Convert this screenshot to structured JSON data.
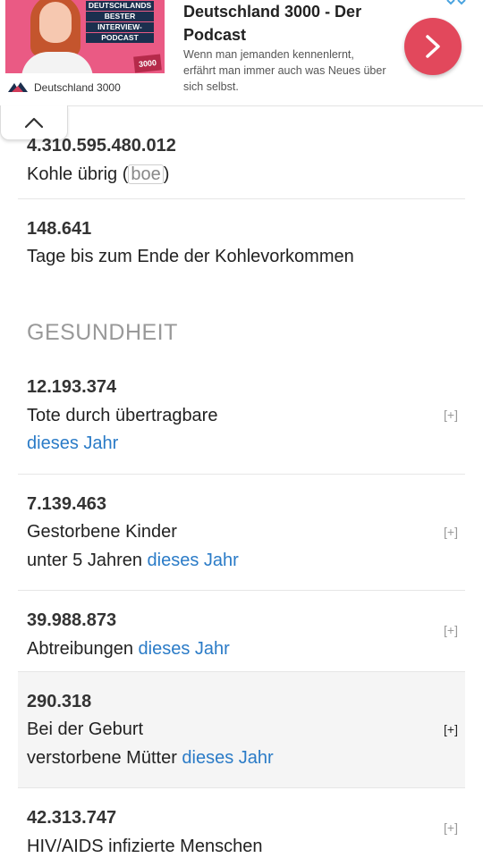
{
  "ad": {
    "cover_lines": [
      "DEUTSCHLANDS",
      "BESTER",
      "INTERVIEW-",
      "PODCAST"
    ],
    "cover_badge": "3000",
    "brand": "Deutschland 3000",
    "title": "Deutschland 3000 - Der Podcast",
    "description": "Wenn man jemanden kennenlernt, erfährt man immer auch was Neues über sich selbst.",
    "cta_icon": "chevron-right-icon",
    "cta_color": "#e2485c",
    "collapse_icon": "chevron-up-icon"
  },
  "energy": {
    "coal": {
      "number": "4.310.595.480.012",
      "label": "Kohle übrig (",
      "unit": "boe",
      "label_end": ")"
    },
    "coal_days": {
      "number": "148.641",
      "label": "Tage bis zum Ende der Kohlevorkommen"
    }
  },
  "health": {
    "title": "GESUNDHEIT",
    "items": [
      {
        "number": "12.193.374",
        "line1": "Tote durch übertragbare",
        "line2": "",
        "link": "dieses Jahr",
        "expand": "[+]"
      },
      {
        "number": "7.139.463",
        "line1": "Gestorbene Kinder",
        "line2": "unter 5 Jahren ",
        "link": "dieses Jahr",
        "expand": "[+]"
      },
      {
        "number": "39.988.873",
        "line1": "Abtreibungen ",
        "link": "dieses Jahr",
        "expand": "[+]"
      },
      {
        "number": "290.318",
        "line1": "Bei der Geburt",
        "line2": "verstorbene Mütter ",
        "link": "dieses Jahr",
        "expand": "[+]"
      },
      {
        "number": "42.313.747",
        "line1": "HIV/AIDS infizierte Menschen",
        "expand": "[+]"
      }
    ]
  },
  "colors": {
    "link": "#2a7bc7",
    "section_title": "#999999",
    "highlight_row": "#f5f5f5"
  }
}
